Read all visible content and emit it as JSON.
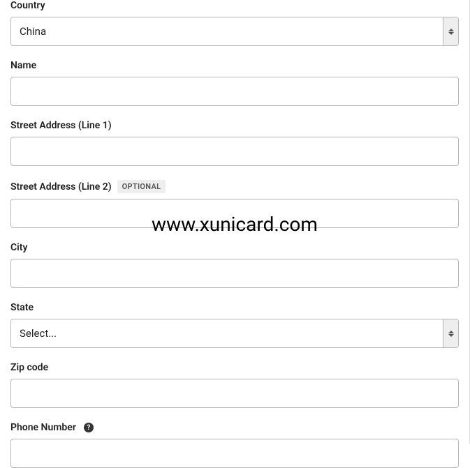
{
  "fields": {
    "country": {
      "label": "Country",
      "value": "China"
    },
    "name": {
      "label": "Name",
      "value": ""
    },
    "street1": {
      "label": "Street Address (Line 1)",
      "value": ""
    },
    "street2": {
      "label": "Street Address (Line 2)",
      "optional_badge": "OPTIONAL",
      "value": ""
    },
    "city": {
      "label": "City",
      "value": ""
    },
    "state": {
      "label": "State",
      "value": "Select..."
    },
    "zip": {
      "label": "Zip code",
      "value": ""
    },
    "phone": {
      "label": "Phone Number",
      "value": ""
    }
  },
  "watermark": "www.xunicard.com"
}
